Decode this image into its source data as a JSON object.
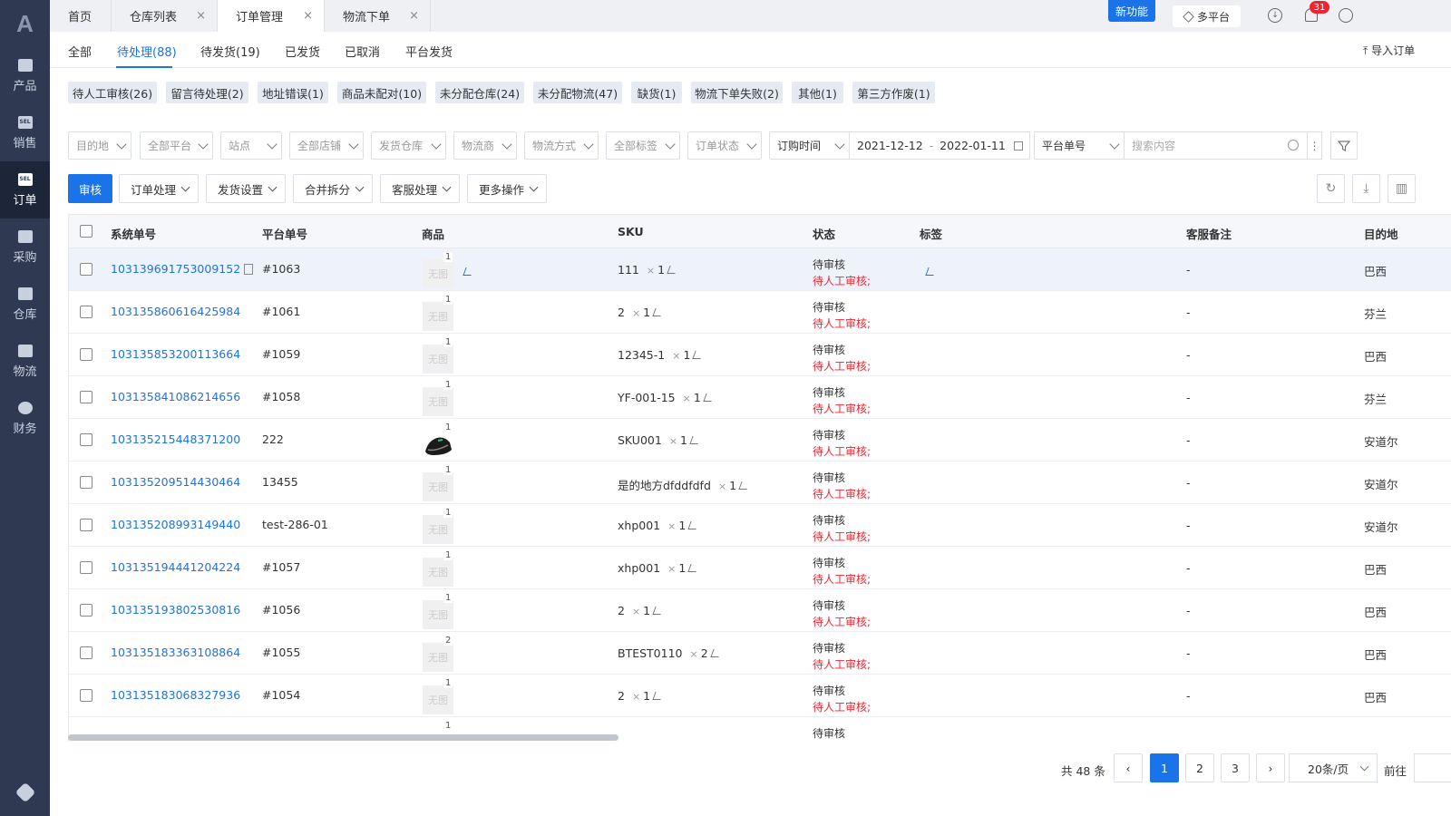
{
  "brand": {
    "logo": "A",
    "accent": "#1a73e8",
    "sidebar_bg": "#2f3a52"
  },
  "sidebar": {
    "items": [
      {
        "label": "产品",
        "icon": "bag-icon"
      },
      {
        "label": "销售",
        "icon": "sell-icon"
      },
      {
        "label": "订单",
        "icon": "sell-icon"
      },
      {
        "label": "采购",
        "icon": "cart-icon"
      },
      {
        "label": "仓库",
        "icon": "warehouse-icon"
      },
      {
        "label": "物流",
        "icon": "truck-icon"
      },
      {
        "label": "财务",
        "icon": "money-icon"
      }
    ],
    "active_index": 2,
    "bottom_icon": "settings-icon"
  },
  "topbar": {
    "tabs": [
      {
        "label": "首页",
        "close": ""
      },
      {
        "label": "仓库列表",
        "close": "×"
      },
      {
        "label": "订单管理",
        "close": "×"
      },
      {
        "label": "物流下单",
        "close": "×"
      }
    ],
    "active_index": 2,
    "new_feature": "新功能",
    "multi_platform": "多平台",
    "notification_count": "31"
  },
  "status_tabs": {
    "items": [
      "全部",
      "待处理(88)",
      "待发货(19)",
      "已发货",
      "已取消",
      "平台发货"
    ],
    "active_index": 1,
    "import_order": "导入订单"
  },
  "chips": [
    "待人工审核(26)",
    "留言待处理(2)",
    "地址错误(1)",
    "商品未配对(10)",
    "未分配仓库(24)",
    "未分配物流(47)",
    "缺货(1)",
    "物流下单失败(2)",
    "其他(1)",
    "第三方作废(1)"
  ],
  "filters": {
    "dropdowns": [
      "目的地",
      "全部平台",
      "站点",
      "全部店铺",
      "发货仓库",
      "物流商",
      "物流方式",
      "全部标签",
      "订单状态"
    ],
    "date_type": "订购时间",
    "date_from": "2021-12-12",
    "date_sep": "-",
    "date_to": "2022-01-11",
    "search_type": "平台单号",
    "search_placeholder": "搜索内容"
  },
  "actions": {
    "primary": "审核",
    "dropdowns": [
      "订单处理",
      "发货设置",
      "合并拆分",
      "客服处理",
      "更多操作"
    ]
  },
  "table": {
    "columns": {
      "sys_no": "系统单号",
      "platform_no": "平台单号",
      "product": "商品",
      "sku": "SKU",
      "status": "状态",
      "tag": "标签",
      "cs_note": "客服备注",
      "dest": "目的地"
    },
    "no_image": "无图",
    "x_sign": "×",
    "rows": [
      {
        "sys_no": "103139691753009152",
        "platform_no": "#1063",
        "img_count": "1",
        "sku": "111",
        "qty": "1",
        "status": "待审核",
        "sub_status": "待人工审核;",
        "note": "-",
        "dest": "巴西"
      },
      {
        "sys_no": "103135860616425984",
        "platform_no": "#1061",
        "img_count": "1",
        "sku": "2",
        "qty": "1",
        "status": "待审核",
        "sub_status": "待人工审核;",
        "note": "-",
        "dest": "芬兰"
      },
      {
        "sys_no": "103135853200113664",
        "platform_no": "#1059",
        "img_count": "1",
        "sku": "12345-1",
        "qty": "1",
        "status": "待审核",
        "sub_status": "待人工审核;",
        "note": "-",
        "dest": "巴西"
      },
      {
        "sys_no": "103135841086214656",
        "platform_no": "#1058",
        "img_count": "1",
        "sku": "YF-001-15",
        "qty": "1",
        "status": "待审核",
        "sub_status": "待人工审核;",
        "note": "-",
        "dest": "芬兰"
      },
      {
        "sys_no": "103135215448371200",
        "platform_no": "222",
        "img_count": "1",
        "sku": "SKU001",
        "qty": "1",
        "status": "待审核",
        "sub_status": "待人工审核;",
        "note": "-",
        "dest": "安道尔"
      },
      {
        "sys_no": "103135209514430464",
        "platform_no": "13455",
        "img_count": "1",
        "sku": "是的地方dfddfdfd",
        "qty": "1",
        "status": "待审核",
        "sub_status": "待人工审核;",
        "note": "-",
        "dest": "安道尔"
      },
      {
        "sys_no": "103135208993149440",
        "platform_no": "test-286-01",
        "img_count": "1",
        "sku": "xhp001",
        "qty": "1",
        "status": "待审核",
        "sub_status": "待人工审核;",
        "note": "-",
        "dest": "安道尔"
      },
      {
        "sys_no": "103135194441204224",
        "platform_no": "#1057",
        "img_count": "1",
        "sku": "xhp001",
        "qty": "1",
        "status": "待审核",
        "sub_status": "待人工审核;",
        "note": "-",
        "dest": "巴西"
      },
      {
        "sys_no": "103135193802530816",
        "platform_no": "#1056",
        "img_count": "1",
        "sku": "2",
        "qty": "1",
        "status": "待审核",
        "sub_status": "待人工审核;",
        "note": "-",
        "dest": "巴西"
      },
      {
        "sys_no": "103135183363108864",
        "platform_no": "#1055",
        "img_count": "2",
        "sku": "BTEST0110",
        "qty": "2",
        "status": "待审核",
        "sub_status": "待人工审核;",
        "note": "-",
        "dest": "巴西"
      },
      {
        "sys_no": "103135183068327936",
        "platform_no": "#1054",
        "img_count": "1",
        "sku": "2",
        "qty": "1",
        "status": "待审核",
        "sub_status": "待人工审核;",
        "note": "-",
        "dest": "巴西"
      }
    ],
    "partial_row": {
      "img_count": "1",
      "status": "待审核"
    }
  },
  "pagination": {
    "total": "共 48 条",
    "pages": [
      "1",
      "2",
      "3"
    ],
    "current": "1",
    "page_size": "20条/页",
    "goto": "前往",
    "prev": "‹",
    "next": "›"
  }
}
